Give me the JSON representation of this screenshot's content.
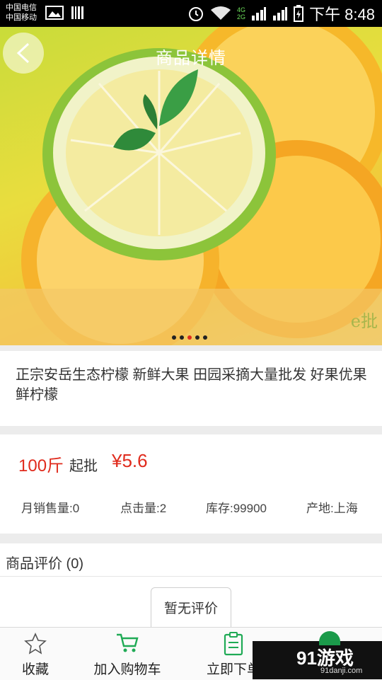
{
  "status_bar": {
    "carrier1": "中国电信",
    "carrier2": "中国移动",
    "network1": "4G",
    "network2": "2G",
    "time": "下午 8:48"
  },
  "header": {
    "title": "商品详情"
  },
  "hero": {
    "watermark": "e批",
    "carousel_total": 5,
    "carousel_active": 3
  },
  "product": {
    "title": "正宗安岳生态柠檬 新鲜大果 田园采摘大量批发 好果优果鲜柠檬",
    "min_qty": "100斤",
    "min_qty_label": "起批",
    "price": "¥5.6",
    "stats": {
      "monthly_sales": "月销售量:0",
      "clicks": "点击量:2",
      "stock": "库存:99900",
      "origin": "产地:上海"
    }
  },
  "reviews": {
    "heading": "商品评价 (0)",
    "empty_label": "暂无评价"
  },
  "bottom_bar": {
    "favorite": "收藏",
    "add_to_cart": "加入购物车",
    "order_now": "立即下单"
  },
  "promo": {
    "main": "91游戏",
    "sub": "91danji.com"
  },
  "colors": {
    "accent_red": "#e02b1d",
    "cart_green": "#1faa55"
  }
}
